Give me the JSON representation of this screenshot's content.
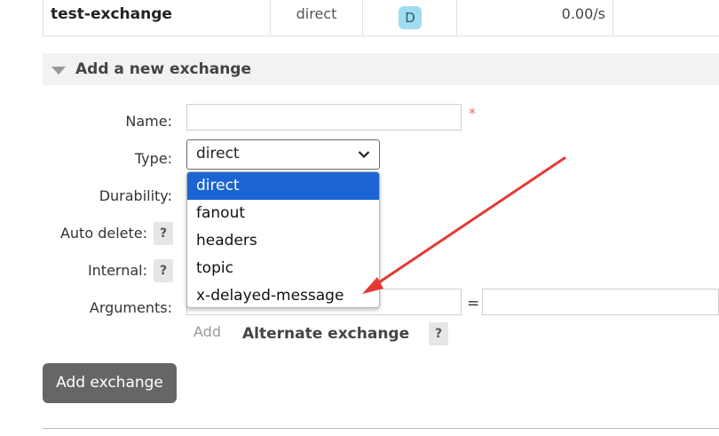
{
  "exchange_row": {
    "name": "test-exchange",
    "type": "direct",
    "feature_badge": "D",
    "rate": "0.00/s"
  },
  "section": {
    "title": "Add a new exchange"
  },
  "form": {
    "name_label": "Name:",
    "required_mark": "*",
    "type_label": "Type:",
    "type_value": "direct",
    "durability_label": "Durability:",
    "auto_delete_label": "Auto delete:",
    "internal_label": "Internal:",
    "arguments_label": "Arguments:",
    "help_mark": "?",
    "equals": "=",
    "add_link": "Add",
    "alternate_exchange_label": "Alternate exchange",
    "submit_label": "Add exchange"
  },
  "dropdown": {
    "options": [
      "direct",
      "fanout",
      "headers",
      "topic",
      "x-delayed-message"
    ],
    "selected": "direct"
  },
  "colors": {
    "selected_option_bg": "#1c64d4",
    "annotation_arrow": "#e53935",
    "badge_bg": "#9fdcf0"
  },
  "icons": {
    "collapse": "triangle-down-icon",
    "select": "chevron-down-icon",
    "annotation": "red-arrow-icon"
  }
}
